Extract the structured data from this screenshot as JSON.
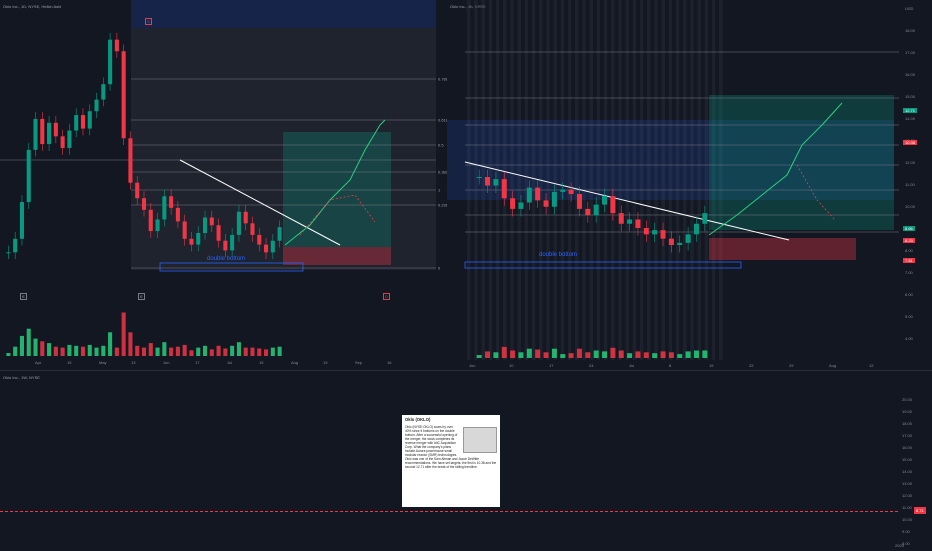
{
  "chart_data": [
    {
      "type": "candlestick",
      "legend": "Oklo Inc., 1D, NYSE, Heikin Ashi",
      "x_ticks": [
        "Apr",
        "15",
        "May",
        "13",
        "Jun",
        "17",
        "Jul",
        "15",
        "Aug",
        "19",
        "Sep",
        "16"
      ],
      "horizontal_levels": [
        {
          "label": "0.786",
          "value": 0.786
        },
        {
          "label": "0.618",
          "value": 0.618
        },
        {
          "label": "0.5",
          "value": 0.5
        },
        {
          "label": "0.382",
          "value": 0.382
        },
        {
          "label": "0.236",
          "value": 0.236
        },
        {
          "label": "0",
          "value": 0
        },
        {
          "label": "1",
          "value": 1
        }
      ],
      "annotation": "double bottom",
      "closes": [
        6.5,
        7.2,
        9.1,
        11.8,
        13.4,
        12.1,
        13.2,
        12.5,
        11.9,
        12.8,
        13.6,
        12.9,
        13.8,
        14.4,
        15.2,
        17.5,
        16.9,
        12.4,
        10.1,
        9.3,
        8.7,
        7.6,
        8.2,
        9.4,
        8.8,
        8.1,
        7.2,
        6.9,
        7.5,
        8.3,
        7.9,
        7.1,
        6.6,
        7.4,
        8.6,
        8.0,
        7.4,
        6.9,
        6.5,
        7.1,
        7.8
      ]
    },
    {
      "type": "candlestick",
      "legend": "Oklo Inc., 4h, NYSE",
      "price_scale": [
        "USD",
        "18.00",
        "17.00",
        "16.00",
        "15.00",
        "14.00",
        "13.00",
        "12.00",
        "11.00",
        "10.00",
        "9.00",
        "8.00",
        "7.00",
        "6.00",
        "5.00",
        "4.00"
      ],
      "price_tags": [
        {
          "label": "12.71",
          "color": "#089981"
        },
        {
          "label": "10.38",
          "color": "#f23645"
        },
        {
          "label": "8.66",
          "color": "#089981"
        },
        {
          "label": "8.23",
          "color": "#f23645"
        },
        {
          "label": "7.81",
          "color": "#f23645"
        }
      ],
      "x_ticks": [
        "Jun",
        "10",
        "17",
        "24",
        "Jul",
        "8",
        "15",
        "22",
        "29",
        "Aug",
        "12"
      ],
      "annotation": "double bottom",
      "closes": [
        10.6,
        10.2,
        10.5,
        9.6,
        9.1,
        9.4,
        10.1,
        9.5,
        9.2,
        9.9,
        10.0,
        9.8,
        9.1,
        8.8,
        9.3,
        9.7,
        8.9,
        8.4,
        8.6,
        8.2,
        7.9,
        8.1,
        7.7,
        7.4,
        7.5,
        7.9,
        8.4,
        8.9
      ]
    },
    {
      "type": "line",
      "legend": "Oklo Inc., 1W, NYSE",
      "price_scale": [
        "20.00",
        "19.00",
        "18.00",
        "17.00",
        "16.00",
        "15.00",
        "14.00",
        "13.00",
        "12.00",
        "11.00",
        "10.00",
        "9.00",
        "8.00"
      ],
      "last_price": "8.71",
      "x_ticks": [
        "2024"
      ]
    }
  ],
  "note": {
    "title": "Oklo (OKLO)",
    "body": "Oklo (NYSE:OKLO) soars by over 40% since it bottoms on the double bottom. After a successful opening of the merger, the stock completes its reverse merger with AltC Acquisition Corp. What the company's plans include Aurora powerhouse small modular reactor (SMR) technologies. Oklo was one of the Sam Altman and Jacob DeWitte recommendations. We have set targets: the first is 10.38 and the second 12.71 after the break of the falling trendline."
  }
}
